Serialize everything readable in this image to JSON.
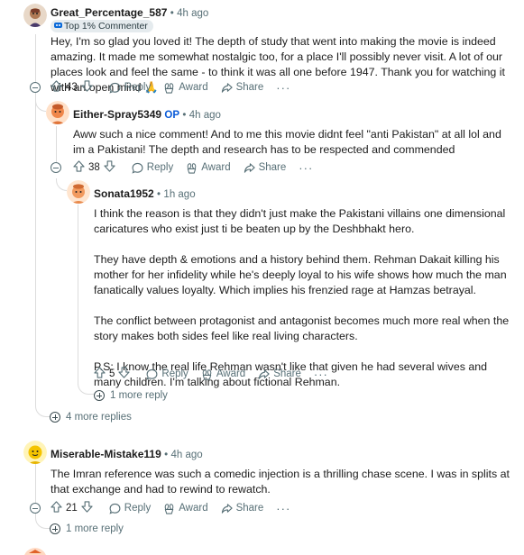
{
  "comments": {
    "c1": {
      "username": "Great_Percentage_587",
      "time": "4h ago",
      "flair": "Top 1% Commenter",
      "body": "Hey, I'm so glad you loved it! The depth of study that went into making the movie is indeed amazing. It made me somewhat nostalgic too, for a place I'll possibly never visit. A lot of our places look and feel the same - to think it was all one before 1947. Thank you for watching it with an open mind 🙏",
      "votes": "43",
      "more_replies": "4 more replies"
    },
    "c2": {
      "username": "Either-Spray5349",
      "op": "OP",
      "time": "4h ago",
      "body": "Aww such a nice comment! And to me this movie didnt feel \"anti Pakistan\" at all lol and im a Pakistani! The depth and research has to be respected and commended",
      "votes": "38"
    },
    "c3": {
      "username": "Sonata1952",
      "time": "1h ago",
      "paragraphs": [
        "I think the reason is that they didn't just make the Pakistani villains one dimensional caricatures who exist just ti be beaten up by the Deshbhakt hero.",
        "They have depth & emotions and a history behind them. Rehman Dakait killing his mother for her infidelity while he's deeply loyal to his wife shows how much the man fanatically values loyalty. Which implies his frenzied rage at Hamzas betrayal.",
        "The conflict between protagonist and antagonist becomes much more real when the story makes both sides feel like real living characters.",
        "P.S: I know the real life Rehman wasn't like that given he had several wives and many children. I'm talking about fictional Rehman."
      ],
      "votes": "5",
      "more_replies": "1 more reply"
    },
    "c4": {
      "username": "Miserable-Mistake119",
      "time": "4h ago",
      "body": "The Imran reference was such a comedic injection is a thrilling chase scene. I was in splits at that exchange and had to rewind to rewatch.",
      "votes": "21",
      "more_replies": "1 more reply"
    }
  },
  "labels": {
    "reply": "Reply",
    "award": "Award",
    "share": "Share",
    "overflow": "···",
    "sep": "•"
  },
  "colors": {
    "op": "#0a5bd8",
    "meta": "#576f76",
    "thread_line": "#dcdcdc"
  }
}
